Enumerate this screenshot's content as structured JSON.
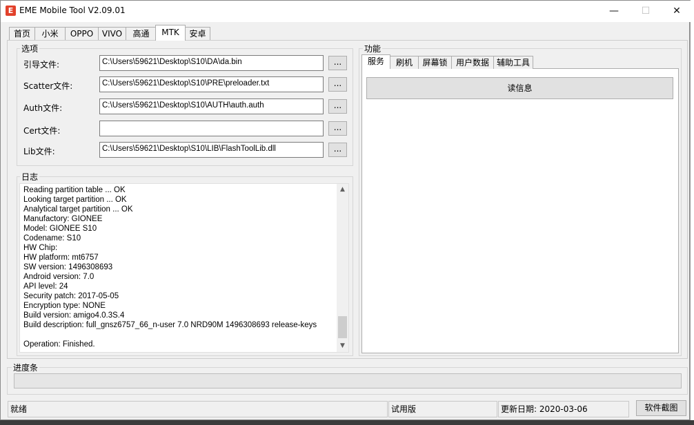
{
  "window": {
    "title": "EME Mobile Tool V2.09.01",
    "icon_glyph": "E",
    "controls": {
      "minimize": "—",
      "maximize": "☐",
      "close": "✕"
    }
  },
  "main_tabs": [
    "首页",
    "小米",
    "OPPO",
    "VIVO",
    "高通",
    "MTK",
    "安卓"
  ],
  "active_main_tab": "MTK",
  "options": {
    "legend": "选项",
    "fields": [
      {
        "label": "引导文件:",
        "value": "C:\\Users\\59621\\Desktop\\S10\\DA\\da.bin",
        "button": "..."
      },
      {
        "label": "Scatter文件:",
        "value": "C:\\Users\\59621\\Desktop\\S10\\PRE\\preloader.txt",
        "button": "..."
      },
      {
        "label": "Auth文件:",
        "value": "C:\\Users\\59621\\Desktop\\S10\\AUTH\\auth.auth",
        "button": "..."
      },
      {
        "label": "Cert文件:",
        "value": "",
        "button": "..."
      },
      {
        "label": "Lib文件:",
        "value": "C:\\Users\\59621\\Desktop\\S10\\LIB\\FlashToolLib.dll",
        "button": "..."
      }
    ]
  },
  "log": {
    "legend": "日志",
    "lines": [
      "Reading partition table ... OK",
      "Looking target partition ... OK",
      "Analytical target partition ... OK",
      "Manufactory: GIONEE",
      "Model: GIONEE S10",
      "Codename: S10",
      "HW Chip:",
      "HW platform: mt6757",
      "SW version: 1496308693",
      "Android version: 7.0",
      "API level: 24",
      "Security patch: 2017-05-05",
      "Encryption type: NONE",
      "Build version: amigo4.0.3S.4",
      "Build description: full_gnsz6757_66_n-user 7.0 NRD90M 1496308693 release-keys",
      "",
      "Operation: Finished."
    ],
    "scroll_up": "▲",
    "scroll_down": "▼"
  },
  "functions": {
    "legend": "功能",
    "tabs": [
      "服务",
      "刷机",
      "屏幕锁",
      "用户数据",
      "辅助工具"
    ],
    "active_tab": "服务",
    "read_info_button": "读信息"
  },
  "progress": {
    "legend": "进度条",
    "value": 0
  },
  "status_bar": {
    "status": "就绪",
    "edition": "试用版",
    "update_date": "更新日期:  2020-03-06",
    "screenshot_button": "软件截图"
  }
}
